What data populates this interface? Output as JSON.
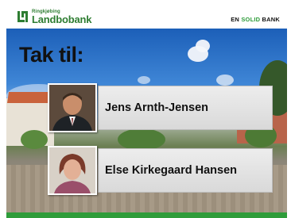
{
  "header": {
    "logo_small": "Ringkjøbing",
    "logo_name": "Landbobank",
    "tagline_prefix": "EN ",
    "tagline_highlight": "SOLID",
    "tagline_suffix": " BANK"
  },
  "slide": {
    "title": "Tak til:",
    "people": [
      {
        "name": "Jens Arnth-Jensen"
      },
      {
        "name": "Else Kirkegaard Hansen"
      }
    ]
  },
  "colors": {
    "brand_green": "#2e9c3a",
    "card_bg": "#e3e3e3"
  }
}
